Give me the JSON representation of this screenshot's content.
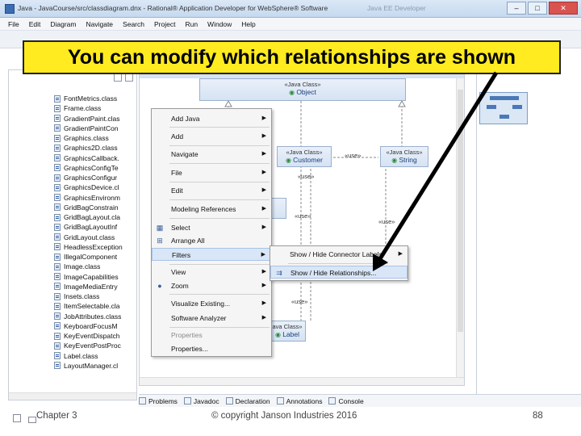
{
  "window": {
    "title": "Java - JavaCourse/src/classdiagram.dnx - Rational® Application Developer for WebSphere® Software",
    "title_right": "Java EE Developer",
    "buttons": [
      "–",
      "□",
      "✕"
    ]
  },
  "menubar": [
    "File",
    "Edit",
    "Diagram",
    "Navigate",
    "Search",
    "Project",
    "Run",
    "Window",
    "Help"
  ],
  "banner": {
    "text": "You can modify which relationships are shown"
  },
  "explorer": {
    "classes": [
      "FontMetrics.class",
      "Frame.class",
      "GradientPaint.clas",
      "GradientPaintCon",
      "Graphics.class",
      "Graphics2D.class",
      "GraphicsCallback.",
      "GraphicsConfigTe",
      "GraphicsConfigur",
      "GraphicsDevice.cl",
      "GraphicsEnvironm",
      "GridBagConstrain",
      "GridBagLayout.cla",
      "GridBagLayoutInf",
      "GridLayout.class",
      "HeadlessException",
      "IllegalComponent",
      "Image.class",
      "ImageCapabilities",
      "ImageMediaEntry",
      "Insets.class",
      "ItemSelectable.cla",
      "JobAttributes.class",
      "KeyboardFocusM",
      "KeyEventDispatch",
      "KeyEventPostProc",
      "Label.class",
      "LayoutManager.cl"
    ]
  },
  "diagram": {
    "object_class": {
      "stereotype": "«Java Class»",
      "name": "Object"
    },
    "customer_class": {
      "stereotype": "«Java Class»",
      "name": "Customer"
    },
    "string_class": {
      "stereotype": "«Java Class»",
      "name": "String"
    },
    "label_class": {
      "stereotype": "ava Class»",
      "name": "Label"
    },
    "relationship_labels": [
      "«use»",
      "«use»",
      "«use»",
      "«use»",
      "«use»"
    ]
  },
  "context_menu": {
    "items": [
      {
        "label": "Add Java",
        "submenu": true
      },
      {
        "label": "Add",
        "submenu": true
      },
      {
        "label": "Navigate",
        "submenu": true
      },
      {
        "label": "File",
        "submenu": true
      },
      {
        "label": "Edit",
        "submenu": true
      },
      {
        "label": "Modeling References",
        "submenu": true
      },
      {
        "label": "Select",
        "submenu": true
      },
      {
        "label": "Arrange All",
        "submenu": false
      },
      {
        "label": "Filters",
        "submenu": true
      },
      {
        "label": "View",
        "submenu": true
      },
      {
        "label": "Zoom",
        "submenu": true
      },
      {
        "label": "Visualize Existing...",
        "submenu": true
      },
      {
        "label": "Software Analyzer",
        "submenu": true
      },
      {
        "label": "Properties",
        "submenu": false,
        "disabled": true
      },
      {
        "label": "Properties...",
        "submenu": false
      }
    ]
  },
  "submenu": {
    "items": [
      {
        "label": "Show / Hide Connector Labels",
        "submenu": true
      },
      {
        "label": "Show / Hide Relationships..."
      }
    ]
  },
  "bottom_tabs": [
    "Problems",
    "Javadoc",
    "Declaration",
    "Annotations",
    "Console"
  ],
  "footer": {
    "chapter": "Chapter 3",
    "copyright": "© copyright Janson Industries 2016",
    "page": "88"
  },
  "colors": {
    "banner": "#ffeb1f",
    "uml_fill": "#d6e3f3",
    "menu_highlight": "#d9e6f7"
  }
}
